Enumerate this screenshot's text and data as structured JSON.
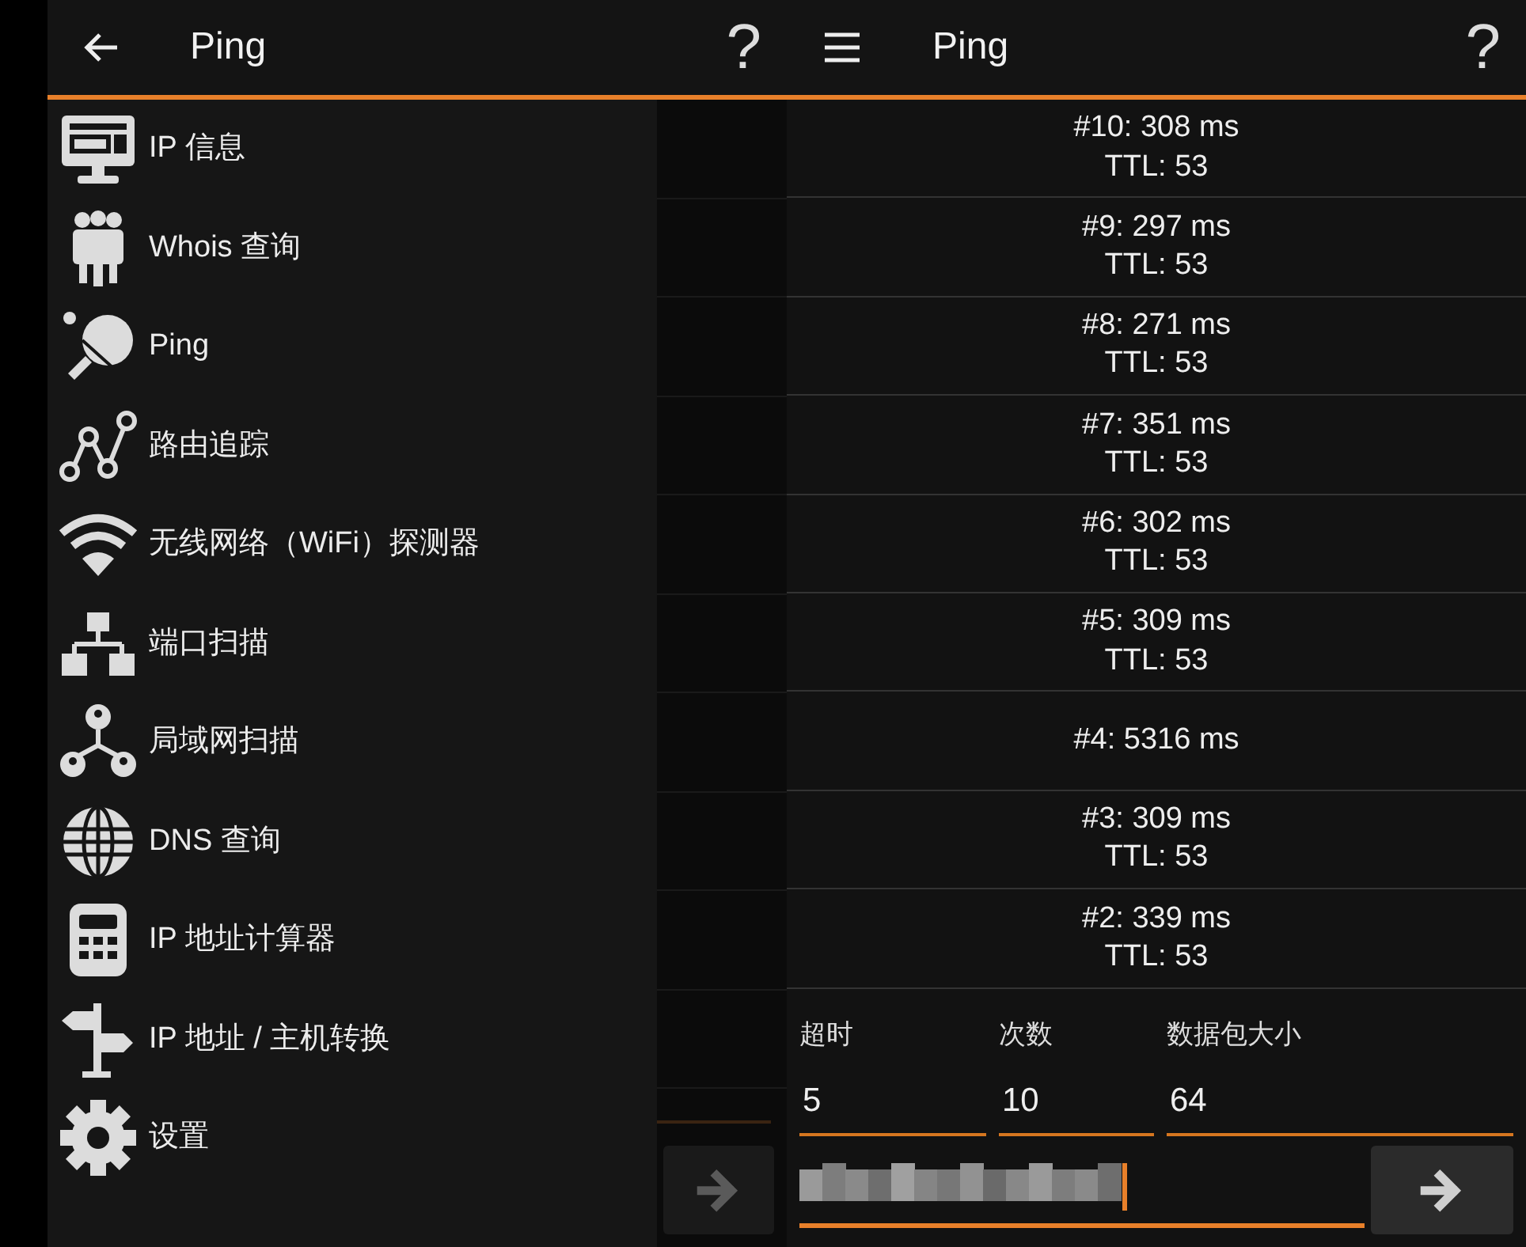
{
  "left_screen": {
    "header": {
      "title": "Ping",
      "help": "?"
    },
    "drawer": {
      "items": [
        {
          "label": "IP 信息"
        },
        {
          "label": "Whois 查询"
        },
        {
          "label": "Ping"
        },
        {
          "label": "路由追踪"
        },
        {
          "label": "无线网络（WiFi）探测器"
        },
        {
          "label": "端口扫描"
        },
        {
          "label": "局域网扫描"
        },
        {
          "label": "DNS 查询"
        },
        {
          "label": "IP 地址计算器"
        },
        {
          "label": "IP 地址 / 主机转换"
        },
        {
          "label": "设置"
        }
      ]
    }
  },
  "right_screen": {
    "header": {
      "title": "Ping",
      "help": "?"
    },
    "results": [
      {
        "line": "#10: 308 ms",
        "ttl": "TTL: 53"
      },
      {
        "line": "#9: 297 ms",
        "ttl": "TTL: 53"
      },
      {
        "line": "#8: 271 ms",
        "ttl": "TTL: 53"
      },
      {
        "line": "#7: 351 ms",
        "ttl": "TTL: 53"
      },
      {
        "line": "#6: 302 ms",
        "ttl": "TTL: 53"
      },
      {
        "line": "#5: 309 ms",
        "ttl": "TTL: 53"
      },
      {
        "line": "#4: 5316 ms"
      },
      {
        "line": "#3: 309 ms",
        "ttl": "TTL: 53"
      },
      {
        "line": "#2: 339 ms",
        "ttl": "TTL: 53"
      }
    ],
    "fields": [
      {
        "label": "超时",
        "value": "5"
      },
      {
        "label": "次数",
        "value": "10"
      },
      {
        "label": "数据包大小",
        "value": "64"
      }
    ]
  }
}
